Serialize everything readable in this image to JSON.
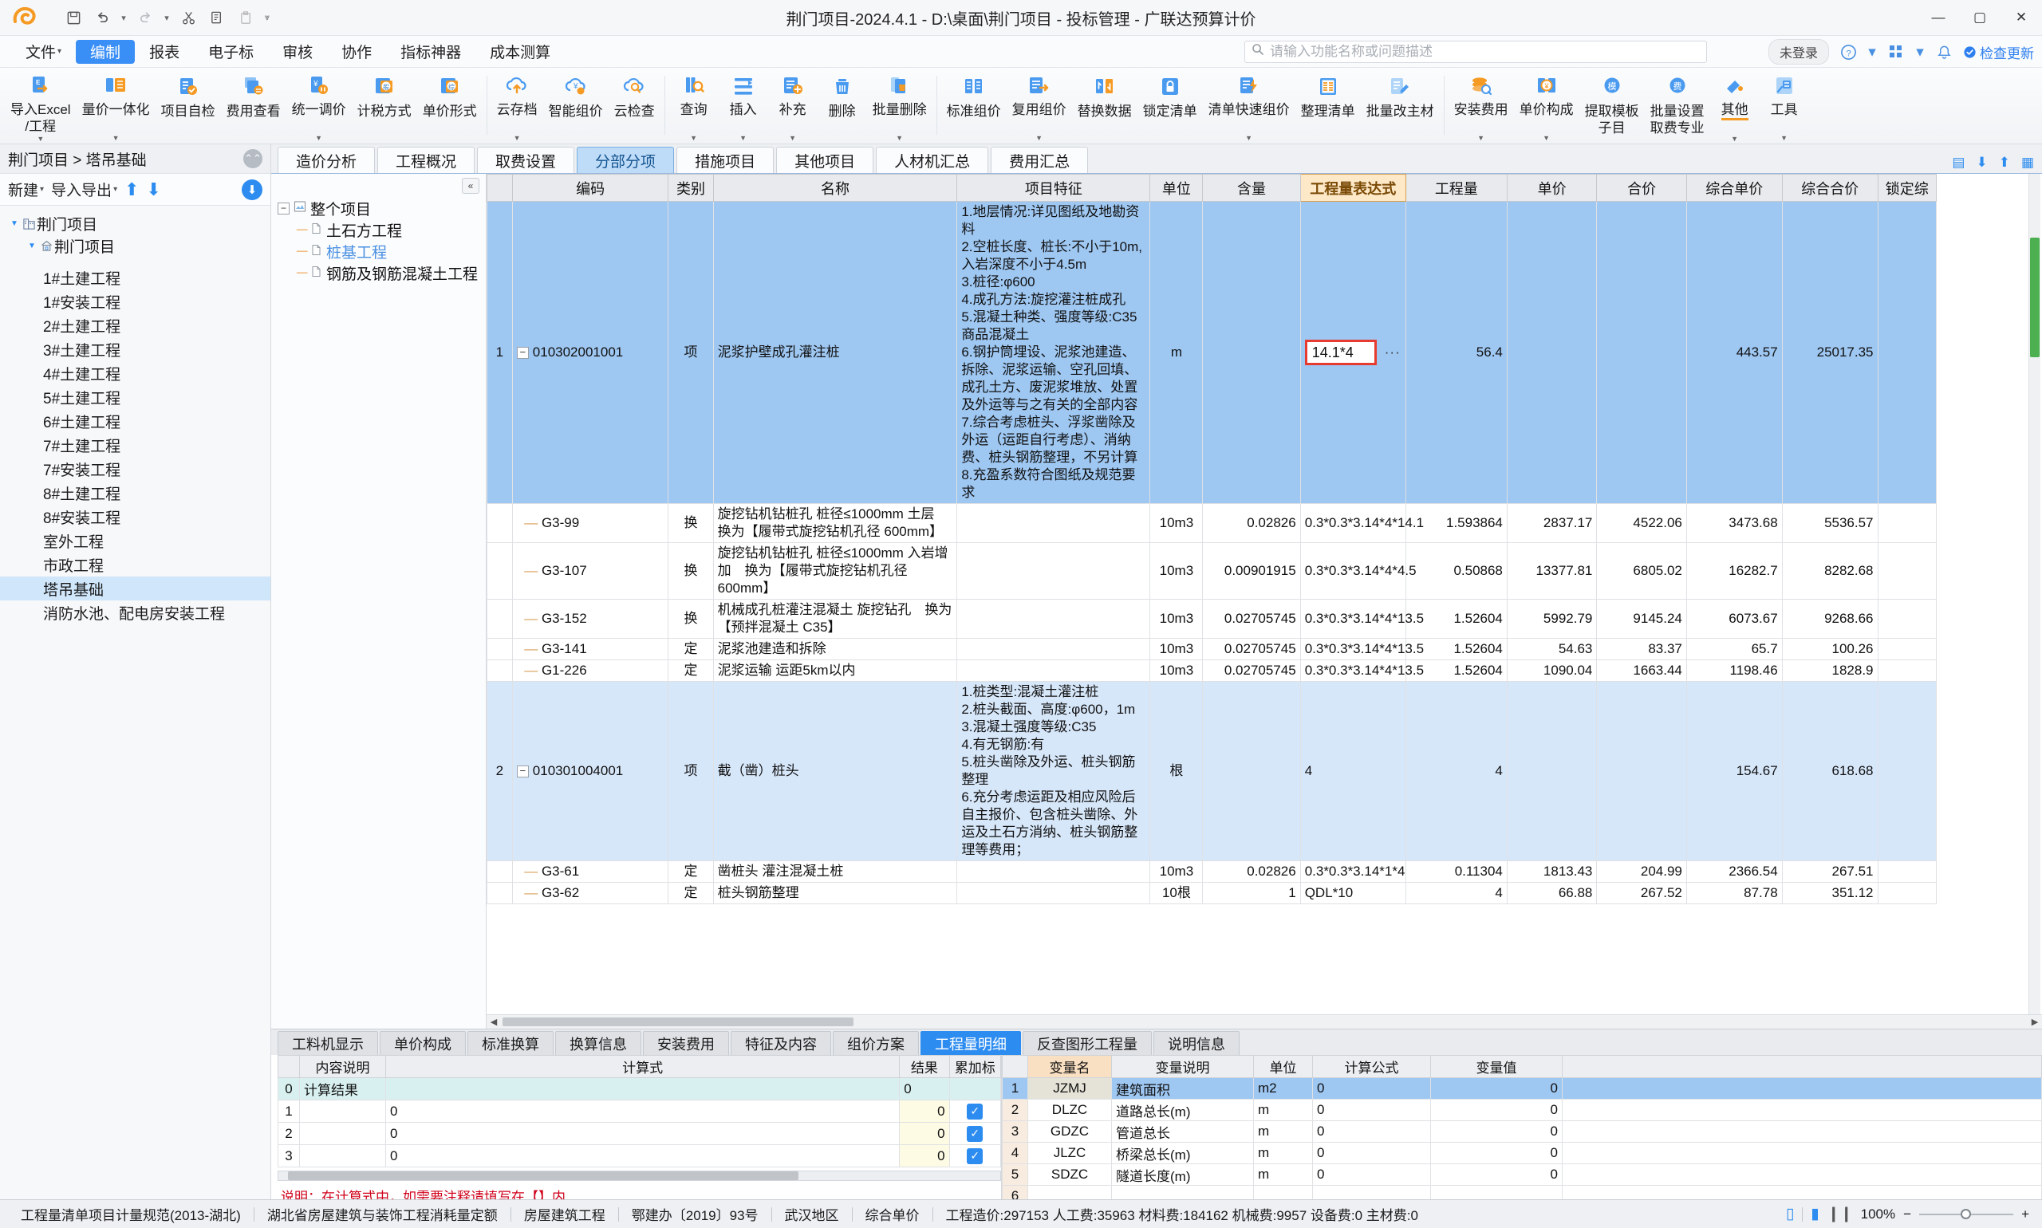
{
  "window": {
    "title": "荆门项目-2024.4.1 - D:\\桌面\\荆门项目 - 投标管理 - 广联达预算计价",
    "minimize": "—",
    "maximize": "▢",
    "close": "✕"
  },
  "quick_access": [
    "save-icon",
    "undo-icon",
    "redo-icon",
    "cut-icon",
    "copy-icon",
    "paste-icon",
    "more-icon"
  ],
  "menu": {
    "items": [
      {
        "label": "文件",
        "caret": true,
        "active": false
      },
      {
        "label": "编制",
        "caret": false,
        "active": true
      },
      {
        "label": "报表",
        "caret": false,
        "active": false
      },
      {
        "label": "电子标",
        "caret": false,
        "active": false
      },
      {
        "label": "审核",
        "caret": false,
        "active": false
      },
      {
        "label": "协作",
        "caret": false,
        "active": false
      },
      {
        "label": "指标神器",
        "caret": false,
        "active": false
      },
      {
        "label": "成本测算",
        "caret": false,
        "active": false
      }
    ],
    "search_placeholder": "请输入功能名称或问题描述",
    "login": "未登录",
    "update": "检查更新"
  },
  "ribbon": [
    {
      "label": "导入Excel",
      "label2": "/工程",
      "icon": "excel-import-icon",
      "dropdown": true
    },
    {
      "label": "量价一体化",
      "label2": "",
      "icon": "quantity-price-icon",
      "dropdown": true
    },
    {
      "label": "项目自检",
      "label2": "",
      "icon": "self-check-icon",
      "dropdown": false
    },
    {
      "label": "费用查看",
      "label2": "",
      "icon": "cost-view-icon",
      "dropdown": false
    },
    {
      "label": "统一调价",
      "label2": "",
      "icon": "unified-price-icon",
      "dropdown": true
    },
    {
      "label": "计税方式",
      "label2": "",
      "icon": "tax-mode-icon",
      "dropdown": false
    },
    {
      "label": "单价形式",
      "label2": "",
      "icon": "unit-price-form-icon",
      "dropdown": false
    },
    {
      "sep": true
    },
    {
      "label": "云存档",
      "label2": "",
      "icon": "cloud-archive-icon",
      "dropdown": true
    },
    {
      "label": "智能组价",
      "label2": "",
      "icon": "smart-price-icon",
      "dropdown": false
    },
    {
      "label": "云检查",
      "label2": "",
      "icon": "cloud-check-icon",
      "dropdown": false
    },
    {
      "sep": true
    },
    {
      "label": "查询",
      "label2": "",
      "icon": "query-icon",
      "dropdown": true
    },
    {
      "label": "插入",
      "label2": "",
      "icon": "insert-icon",
      "dropdown": true
    },
    {
      "label": "补充",
      "label2": "",
      "icon": "supplement-icon",
      "dropdown": true
    },
    {
      "label": "删除",
      "label2": "",
      "icon": "delete-icon",
      "dropdown": false
    },
    {
      "label": "批量删除",
      "label2": "",
      "icon": "batch-delete-icon",
      "dropdown": true
    },
    {
      "sep": true
    },
    {
      "label": "标准组价",
      "label2": "",
      "icon": "standard-price-icon",
      "dropdown": false
    },
    {
      "label": "复用组价",
      "label2": "",
      "icon": "reuse-price-icon",
      "dropdown": true
    },
    {
      "label": "替换数据",
      "label2": "",
      "icon": "replace-data-icon",
      "dropdown": false
    },
    {
      "label": "锁定清单",
      "label2": "",
      "icon": "lock-list-icon",
      "dropdown": false
    },
    {
      "label": "清单快速组价",
      "label2": "",
      "icon": "quick-price-icon",
      "dropdown": true
    },
    {
      "label": "整理清单",
      "label2": "",
      "icon": "organize-list-icon",
      "dropdown": false
    },
    {
      "label": "批量改主材",
      "label2": "",
      "icon": "batch-material-icon",
      "dropdown": false
    },
    {
      "sep": true
    },
    {
      "label": "安装费用",
      "label2": "",
      "icon": "install-cost-icon",
      "dropdown": true
    },
    {
      "label": "单价构成",
      "label2": "",
      "icon": "unit-price-comp-icon",
      "dropdown": true
    },
    {
      "label": "提取模板",
      "label2": "子目",
      "icon": "extract-template-icon",
      "dropdown": false
    },
    {
      "label": "批量设置",
      "label2": "取费专业",
      "icon": "batch-fee-icon",
      "dropdown": false
    },
    {
      "label": "其他",
      "label2": "",
      "icon": "other-icon",
      "dropdown": true
    },
    {
      "label": "工具",
      "label2": "",
      "icon": "tools-icon",
      "dropdown": true
    }
  ],
  "left_panel": {
    "breadcrumb": "荆门项目 > 塔吊基础",
    "toolbar": {
      "new": "新建",
      "import_export": "导入导出",
      "up": "up-arrow-icon",
      "down": "down-arrow-icon",
      "download": "download-icon"
    },
    "tree": [
      {
        "label": "荆门项目",
        "level": 0,
        "icon": "building-icon",
        "twisty": "▼",
        "selected": false
      },
      {
        "label": "荆门项目",
        "level": 1,
        "icon": "home-icon",
        "twisty": "▼",
        "selected": false
      },
      {
        "label": "1#土建工程",
        "level": 2,
        "icon": "",
        "twisty": "",
        "selected": false
      },
      {
        "label": "1#安装工程",
        "level": 2,
        "icon": "",
        "twisty": "",
        "selected": false
      },
      {
        "label": "2#土建工程",
        "level": 2,
        "icon": "",
        "twisty": "",
        "selected": false
      },
      {
        "label": "3#土建工程",
        "level": 2,
        "icon": "",
        "twisty": "",
        "selected": false
      },
      {
        "label": "4#土建工程",
        "level": 2,
        "icon": "",
        "twisty": "",
        "selected": false
      },
      {
        "label": "5#土建工程",
        "level": 2,
        "icon": "",
        "twisty": "",
        "selected": false
      },
      {
        "label": "6#土建工程",
        "level": 2,
        "icon": "",
        "twisty": "",
        "selected": false
      },
      {
        "label": "7#土建工程",
        "level": 2,
        "icon": "",
        "twisty": "",
        "selected": false
      },
      {
        "label": "7#安装工程",
        "level": 2,
        "icon": "",
        "twisty": "",
        "selected": false
      },
      {
        "label": "8#土建工程",
        "level": 2,
        "icon": "",
        "twisty": "",
        "selected": false
      },
      {
        "label": "8#安装工程",
        "level": 2,
        "icon": "",
        "twisty": "",
        "selected": false
      },
      {
        "label": "室外工程",
        "level": 2,
        "icon": "",
        "twisty": "",
        "selected": false
      },
      {
        "label": "市政工程",
        "level": 2,
        "icon": "",
        "twisty": "",
        "selected": false
      },
      {
        "label": "塔吊基础",
        "level": 2,
        "icon": "",
        "twisty": "",
        "selected": true
      },
      {
        "label": "消防水池、配电房安装工程",
        "level": 2,
        "icon": "",
        "twisty": "",
        "selected": false
      }
    ]
  },
  "tabs": [
    {
      "label": "造价分析",
      "active": false
    },
    {
      "label": "工程概况",
      "active": false
    },
    {
      "label": "取费设置",
      "active": false
    },
    {
      "label": "分部分项",
      "active": true
    },
    {
      "label": "措施项目",
      "active": false
    },
    {
      "label": "其他项目",
      "active": false
    },
    {
      "label": "人材机汇总",
      "active": false
    },
    {
      "label": "费用汇总",
      "active": false
    }
  ],
  "subtree": {
    "collapse": "«",
    "nodes": [
      {
        "label": "整个项目",
        "level": 0,
        "expander": "−",
        "icon": "project-icon",
        "selected": false
      },
      {
        "label": "土石方工程",
        "level": 1,
        "expander": "",
        "icon": "doc-icon",
        "selected": false
      },
      {
        "label": "桩基工程",
        "level": 1,
        "expander": "",
        "icon": "doc-icon",
        "selected": true
      },
      {
        "label": "钢筋及钢筋混凝土工程",
        "level": 1,
        "expander": "",
        "icon": "doc-icon",
        "selected": false
      }
    ]
  },
  "grid": {
    "columns": [
      "",
      "编码",
      "类别",
      "名称",
      "项目特征",
      "单位",
      "含量",
      "工程量表达式",
      "工程量",
      "单价",
      "合价",
      "综合单价",
      "综合合价",
      "锁定综"
    ],
    "highlight_column": "工程量表达式",
    "rows": [
      {
        "no": "1",
        "expander": "−",
        "code": "010302001001",
        "cat": "项",
        "name": "泥浆护壁成孔灌注桩",
        "feature": "1.地层情况:详见图纸及地勘资料\n2.空桩长度、桩长:不小于10m,入岩深度不小于4.5m\n3.桩径:φ600\n4.成孔方法:旋挖灌注桩成孔\n5.混凝土种类、强度等级:C35商品混凝土\n6.钢护筒埋设、泥浆池建造、拆除、泥浆运输、空孔回填、成孔土方、废泥浆堆放、处置及外运等与之有关的全部内容\n7.综合考虑桩头、浮浆凿除及外运（运距自行考虑）、消纳费、桩头钢筋整理，不另计算\n8.充盈系数符合图纸及规范要求",
        "unit": "m",
        "content": "",
        "expr": "14.1*4",
        "expr_highlight": true,
        "qty": "56.4",
        "price": "",
        "total": "",
        "comp_price": "443.57",
        "comp_total": "25017.35",
        "lock": "",
        "state": "selected"
      },
      {
        "no": "",
        "expander": "",
        "code": "G3-99",
        "cat": "换",
        "name": "旋挖钻机钻桩孔 桩径≤1000mm 土层　换为【履带式旋挖钻机孔径 600mm】",
        "feature": "",
        "unit": "10m3",
        "content": "0.02826",
        "expr": "0.3*0.3*3.14*4*14.1",
        "expr_highlight": false,
        "qty": "1.593864",
        "price": "2837.17",
        "total": "4522.06",
        "comp_price": "3473.68",
        "comp_total": "5536.57",
        "lock": "",
        "state": "normal"
      },
      {
        "no": "",
        "expander": "",
        "code": "G3-107",
        "cat": "换",
        "name": "旋挖钻机钻桩孔 桩径≤1000mm 入岩增加　换为【履带式旋挖钻机孔径 600mm】",
        "feature": "",
        "unit": "10m3",
        "content": "0.00901915",
        "expr": "0.3*0.3*3.14*4*4.5",
        "expr_highlight": false,
        "qty": "0.50868",
        "price": "13377.81",
        "total": "6805.02",
        "comp_price": "16282.7",
        "comp_total": "8282.68",
        "lock": "",
        "state": "normal"
      },
      {
        "no": "",
        "expander": "",
        "code": "G3-152",
        "cat": "换",
        "name": "机械成孔桩灌注混凝土 旋挖钻孔　换为【预拌混凝土 C35】",
        "feature": "",
        "unit": "10m3",
        "content": "0.02705745",
        "expr": "0.3*0.3*3.14*4*13.5",
        "expr_highlight": false,
        "qty": "1.52604",
        "price": "5992.79",
        "total": "9145.24",
        "comp_price": "6073.67",
        "comp_total": "9268.66",
        "lock": "",
        "state": "normal"
      },
      {
        "no": "",
        "expander": "",
        "code": "G3-141",
        "cat": "定",
        "name": "泥浆池建造和拆除",
        "feature": "",
        "unit": "10m3",
        "content": "0.02705745",
        "expr": "0.3*0.3*3.14*4*13.5",
        "expr_highlight": false,
        "qty": "1.52604",
        "price": "54.63",
        "total": "83.37",
        "comp_price": "65.7",
        "comp_total": "100.26",
        "lock": "",
        "state": "normal"
      },
      {
        "no": "",
        "expander": "",
        "code": "G1-226",
        "cat": "定",
        "name": "泥浆运输 运距5km以内",
        "feature": "",
        "unit": "10m3",
        "content": "0.02705745",
        "expr": "0.3*0.3*3.14*4*13.5",
        "expr_highlight": false,
        "qty": "1.52604",
        "price": "1090.04",
        "total": "1663.44",
        "comp_price": "1198.46",
        "comp_total": "1828.9",
        "lock": "",
        "state": "normal"
      },
      {
        "no": "2",
        "expander": "−",
        "code": "010301004001",
        "cat": "项",
        "name": "截（凿）桩头",
        "feature": "1.桩类型:混凝土灌注桩\n2.桩头截面、高度:φ600，1m\n3.混凝土强度等级:C35\n4.有无钢筋:有\n5.桩头凿除及外运、桩头钢筋整理\n6.充分考虑运距及相应风险后自主报价、包含桩头凿除、外运及土石方消纳、桩头钢筋整理等费用；",
        "unit": "根",
        "content": "",
        "expr": "4",
        "expr_highlight": false,
        "qty": "4",
        "price": "",
        "total": "",
        "comp_price": "154.67",
        "comp_total": "618.68",
        "lock": "",
        "state": "selected2"
      },
      {
        "no": "",
        "expander": "",
        "code": "G3-61",
        "cat": "定",
        "name": "凿桩头 灌注混凝土桩",
        "feature": "",
        "unit": "10m3",
        "content": "0.02826",
        "expr": "0.3*0.3*3.14*1*4",
        "expr_highlight": false,
        "qty": "0.11304",
        "price": "1813.43",
        "total": "204.99",
        "comp_price": "2366.54",
        "comp_total": "267.51",
        "lock": "",
        "state": "normal"
      },
      {
        "no": "",
        "expander": "",
        "code": "G3-62",
        "cat": "定",
        "name": "桩头钢筋整理",
        "feature": "",
        "unit": "10根",
        "content": "1",
        "expr": "QDL*10",
        "expr_highlight": false,
        "qty": "4",
        "price": "66.88",
        "total": "267.52",
        "comp_price": "87.78",
        "comp_total": "351.12",
        "lock": "",
        "state": "normal"
      }
    ]
  },
  "bottom": {
    "tabs": [
      {
        "label": "工料机显示",
        "active": false
      },
      {
        "label": "单价构成",
        "active": false
      },
      {
        "label": "标准换算",
        "active": false
      },
      {
        "label": "换算信息",
        "active": false
      },
      {
        "label": "安装费用",
        "active": false
      },
      {
        "label": "特征及内容",
        "active": false
      },
      {
        "label": "组价方案",
        "active": false
      },
      {
        "label": "工程量明细",
        "active": true
      },
      {
        "label": "反查图形工程量",
        "active": false
      },
      {
        "label": "说明信息",
        "active": false
      }
    ],
    "detail_table": {
      "columns": [
        "",
        "内容说明",
        "计算式",
        "结果",
        "累加标"
      ],
      "rows": [
        {
          "no": "0",
          "desc": "计算结果",
          "formula": "",
          "result": "0",
          "check": false,
          "is_result": true
        },
        {
          "no": "1",
          "desc": "",
          "formula": "0",
          "result": "0",
          "check": true,
          "is_result": false
        },
        {
          "no": "2",
          "desc": "",
          "formula": "0",
          "result": "0",
          "check": true,
          "is_result": false
        },
        {
          "no": "3",
          "desc": "",
          "formula": "0",
          "result": "0",
          "check": true,
          "is_result": false
        }
      ],
      "note": "说明：在计算式中，如需要注释请填写在【】内."
    },
    "vars_table": {
      "columns": [
        "",
        "变量名",
        "变量说明",
        "单位",
        "计算公式",
        "变量值"
      ],
      "rows": [
        {
          "no": "1",
          "name": "JZMJ",
          "desc": "建筑面积",
          "unit": "m2",
          "formula": "0",
          "value": "0",
          "selected": true
        },
        {
          "no": "2",
          "name": "DLZC",
          "desc": "道路总长(m)",
          "unit": "m",
          "formula": "0",
          "value": "0",
          "selected": false
        },
        {
          "no": "3",
          "name": "GDZC",
          "desc": "管道总长",
          "unit": "m",
          "formula": "0",
          "value": "0",
          "selected": false
        },
        {
          "no": "4",
          "name": "JLZC",
          "desc": "桥梁总长(m)",
          "unit": "m",
          "formula": "0",
          "value": "0",
          "selected": false
        },
        {
          "no": "5",
          "name": "SDZC",
          "desc": "隧道长度(m)",
          "unit": "m",
          "formula": "0",
          "value": "0",
          "selected": false
        },
        {
          "no": "6",
          "name": "",
          "desc": "",
          "unit": "",
          "formula": "",
          "value": "",
          "selected": false
        }
      ]
    }
  },
  "status": {
    "segments": [
      "工程量清单项目计量规范(2013-湖北)",
      "湖北省房屋建筑与装饰工程消耗量定额",
      "房屋建筑工程",
      "鄂建办〔2019〕93号",
      "武汉地区",
      "综合单价"
    ],
    "totals": "工程造价:297153  人工费:35963  材料费:184162  机械费:9957  设备费:0  主材费:0",
    "zoom": "100%",
    "zoom_out": "−",
    "zoom_in": "+"
  },
  "colors": {
    "accent": "#2d8cf0",
    "highlight_col": "#fde8c8",
    "selection": "#9ec7f2",
    "warn": "#e63b2e"
  }
}
